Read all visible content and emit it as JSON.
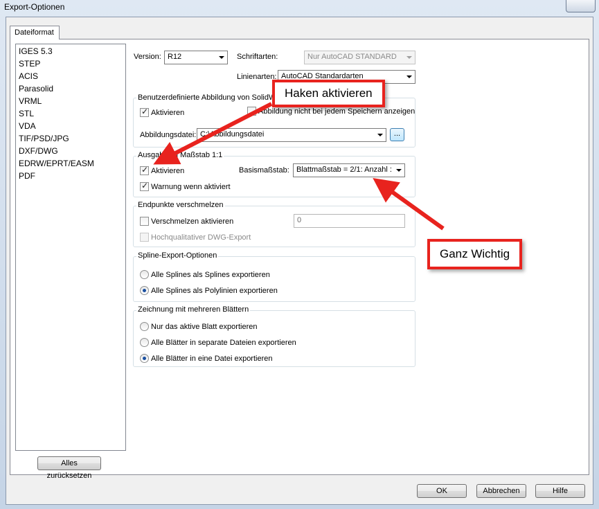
{
  "window": {
    "title": "Export-Optionen"
  },
  "tab": {
    "label": "Dateiformat"
  },
  "formats": [
    "IGES 5.3",
    "STEP",
    "ACIS",
    "Parasolid",
    "VRML",
    "STL",
    "VDA",
    "TIF/PSD/JPG",
    "DXF/DWG",
    "EDRW/EPRT/EASM",
    "PDF"
  ],
  "reset_label": "Alles zurücksetzen",
  "version": {
    "label": "Version:",
    "value": "R12"
  },
  "fonts": {
    "label": "Schriftarten:",
    "value": "Nur AutoCAD STANDARD"
  },
  "linetypes": {
    "label": "Linienarten:",
    "value": "AutoCAD Standardarten"
  },
  "custom_map": {
    "title": "Benutzerdefinierte Abbildung von SolidWorks",
    "activate": "Aktivieren",
    "no_show": "Abbildung nicht bei jedem Speichern anzeigen",
    "file_label": "Abbildungsdatei:",
    "file_value": "C:\\Abbildungsdatei",
    "browse": "..."
  },
  "scale": {
    "title": "Ausgabe im Maßstab 1:1",
    "activate": "Aktivieren",
    "warn": "Warnung wenn aktiviert",
    "base_label": "Basismaßstab:",
    "base_value": "Blattmaßstab = 2/1: Anzahl :"
  },
  "merge": {
    "title": "Endpunkte verschmelzen",
    "activate": "Verschmelzen aktivieren",
    "value": "0",
    "hq": "Hochqualitativer DWG-Export"
  },
  "spline": {
    "title": "Spline-Export-Optionen",
    "opt1": "Alle Splines als Splines exportieren",
    "opt2": "Alle Splines als Polylinien exportieren"
  },
  "sheets": {
    "title": "Zeichnung mit mehreren Blättern",
    "opt1": "Nur das aktive Blatt exportieren",
    "opt2": "Alle Blätter in separate Dateien exportieren",
    "opt3": "Alle Blätter in eine Datei exportieren"
  },
  "buttons": {
    "ok": "OK",
    "cancel": "Abbrechen",
    "help": "Hilfe"
  },
  "annotations": {
    "callout1": "Haken aktivieren",
    "callout2": "Ganz Wichtig"
  },
  "colors": {
    "annotation_red": "#e8231e",
    "radio_dot": "#1a4fa0"
  }
}
